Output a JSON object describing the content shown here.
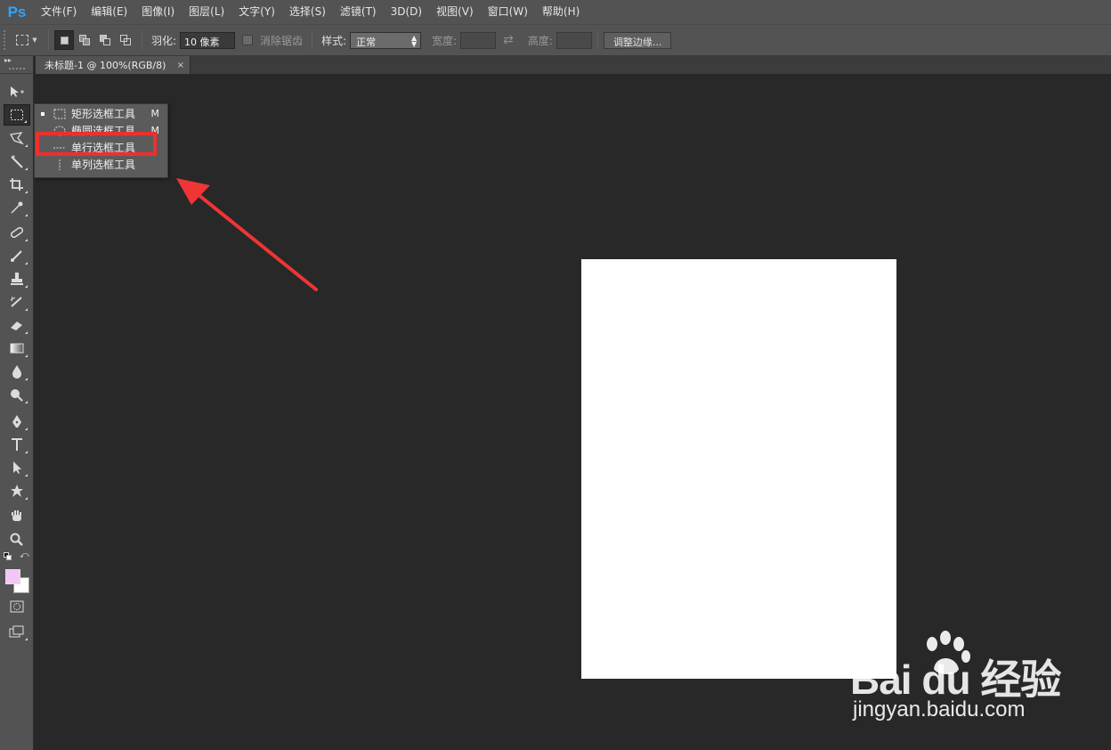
{
  "app": {
    "logo": "Ps"
  },
  "menu": [
    "文件(F)",
    "编辑(E)",
    "图像(I)",
    "图层(L)",
    "文字(Y)",
    "选择(S)",
    "滤镜(T)",
    "3D(D)",
    "视图(V)",
    "窗口(W)",
    "帮助(H)"
  ],
  "options": {
    "feather_label": "羽化:",
    "feather_value": "10 像素",
    "antialias_label": "消除锯齿",
    "style_label": "样式:",
    "style_value": "正常",
    "width_label": "宽度:",
    "height_label": "高度:",
    "refine_edge": "调整边缘..."
  },
  "tab": {
    "title": "未标题-1 @ 100%(RGB/8)",
    "close": "×"
  },
  "flyout": {
    "items": [
      {
        "label": "矩形选框工具",
        "key": "M",
        "selected": true,
        "icon": "rect-marquee-icon"
      },
      {
        "label": "椭圆选框工具",
        "key": "M",
        "selected": false,
        "icon": "ellipse-marquee-icon"
      },
      {
        "label": "单行选框工具",
        "key": "",
        "selected": false,
        "icon": "single-row-marquee-icon"
      },
      {
        "label": "单列选框工具",
        "key": "",
        "selected": false,
        "icon": "single-column-marquee-icon"
      }
    ]
  },
  "colors": {
    "foreground": "#f3c6f5",
    "background": "#ffffff",
    "highlight": "#ef2f2f",
    "accent": "#2fa4ff"
  },
  "watermark": {
    "brand": "Bai du 经验",
    "url": "jingyan.baidu.com"
  }
}
